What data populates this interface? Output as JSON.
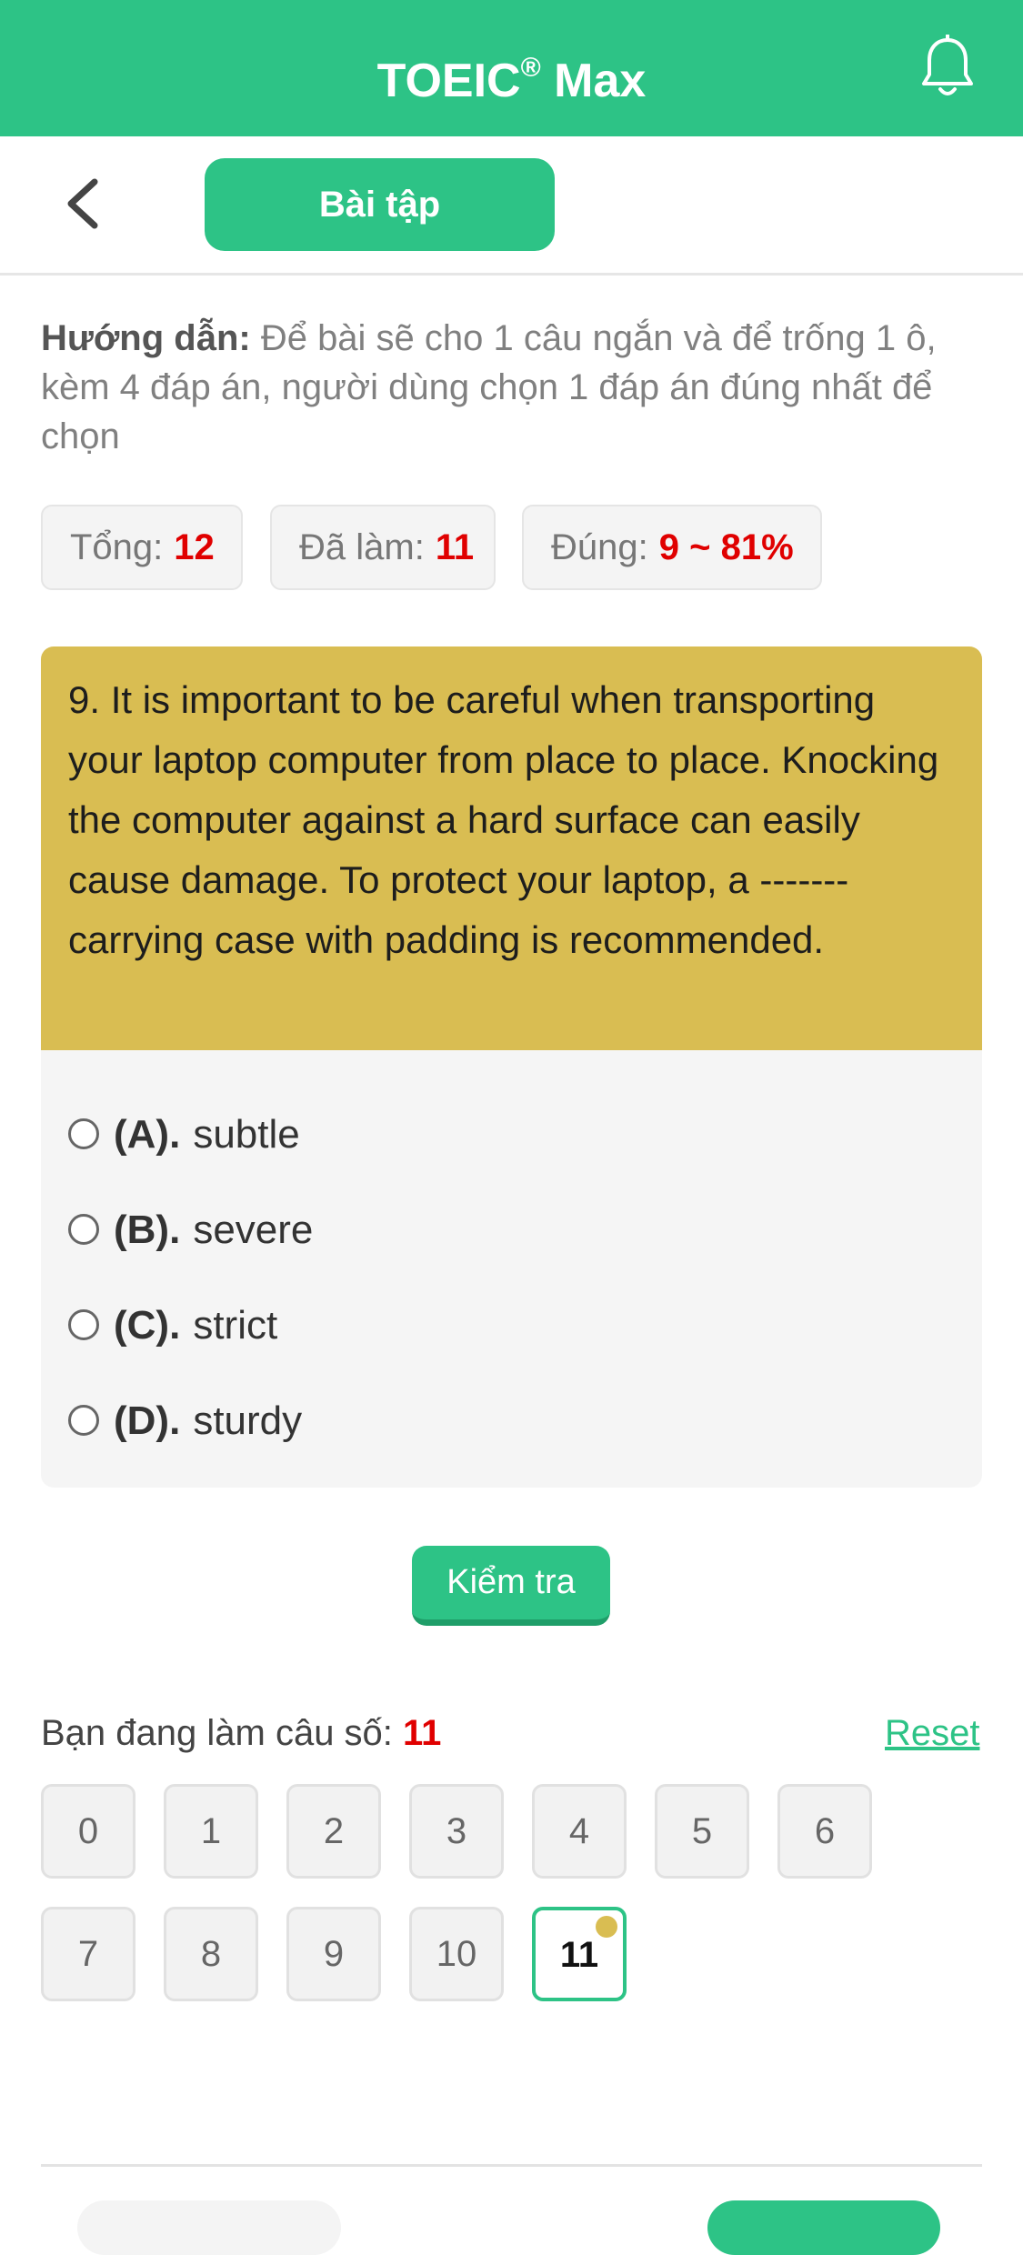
{
  "app": {
    "title": "TOEIC",
    "title_mark": "®",
    "title_suffix": " Max"
  },
  "subheader": {
    "tab_label": "Bài tập"
  },
  "guide": {
    "label": "Hướng dẫn:",
    "text": " Để bài sẽ cho 1 câu ngắn và để trống 1 ô, kèm 4 đáp án, người dùng chọn 1 đáp án đúng nhất để chọn"
  },
  "stats": {
    "total_label": "Tổng:",
    "total_value": "12",
    "done_label": "Đã làm:",
    "done_value": "11",
    "correct_label": "Đúng:",
    "correct_value": "9 ~ 81%"
  },
  "question": {
    "text": "9. It is important to be careful when transporting your laptop computer from place to place. Knocking the computer against a hard surface can easily cause damage. To protect your laptop, a ------- carrying case with padding is recommended.",
    "options": [
      {
        "label": "(A).",
        "text": "subtle"
      },
      {
        "label": "(B).",
        "text": "severe"
      },
      {
        "label": "(C).",
        "text": "strict"
      },
      {
        "label": "(D).",
        "text": "sturdy"
      }
    ]
  },
  "actions": {
    "check_label": "Kiểm tra",
    "reset_label": "Reset"
  },
  "progress": {
    "current_label": "Bạn đang làm câu số:",
    "current_value": "11",
    "numbers": [
      "0",
      "1",
      "2",
      "3",
      "4",
      "5",
      "6",
      "7",
      "8",
      "9",
      "10",
      "11"
    ]
  },
  "colors": {
    "accent": "#2dc386",
    "question_bg": "#d9bd52",
    "highlight": "#e00000"
  }
}
